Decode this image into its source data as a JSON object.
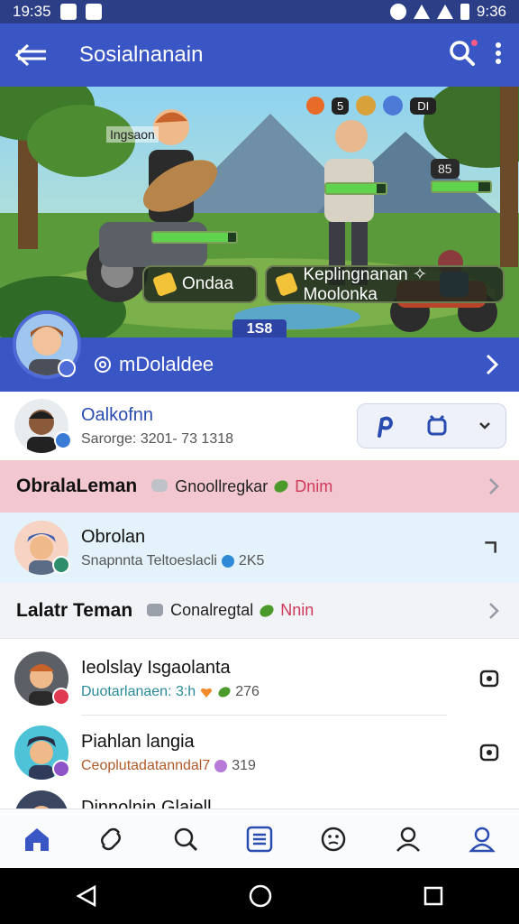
{
  "status_bar": {
    "time": "19:35",
    "time_right": "9:36"
  },
  "app_bar": {
    "title": "Sosialnanain"
  },
  "banner": {
    "hud_top": "5",
    "hud_top_right": "DI",
    "hero_label": "Ingsaon",
    "score": "85",
    "level": "1S8",
    "chip_left": "Ondaa",
    "chip_right": "Keplingnanan ✧ Moolonka"
  },
  "profile": {
    "handle": "mDolaldee"
  },
  "friend_card": {
    "name": "Oalkofnn",
    "sub": "Sarorge: 3201- 73  1318"
  },
  "sections": [
    {
      "title": "ObralaLeman",
      "meta": "Gnoollregkar",
      "accent": "Dnim",
      "color": "#f2c7d0"
    },
    {
      "title": "Lalatr Teman",
      "meta": "Conalregtal",
      "accent": "Nnin",
      "color": "#f2f3f6"
    }
  ],
  "highlight_row": {
    "name": "Obrolan",
    "sub": "Snapnnta Teltoeslacli",
    "count": "2K5"
  },
  "list": [
    {
      "name": "Ieolslay Isgaolanta",
      "sub": "Duotarlanaen: 3:h",
      "count": "276",
      "badge_color": "#e03a53"
    },
    {
      "name": "Piahlan langia",
      "sub": "Ceoplutadatanndal7",
      "count": "319",
      "badge_color": "#8e55c8"
    },
    {
      "name": "Dinnolnin Glaiell",
      "sub": "",
      "count": "",
      "badge_color": "#4f6bd8"
    }
  ],
  "colors": {
    "primary": "#3a56c5",
    "status": "#2c3f86",
    "pink": "#f2c7d0",
    "lightblue": "#e4f3fb"
  },
  "icons": {
    "app_bar": [
      "back-arrow-icon",
      "notification-search-icon",
      "more-vert-icon"
    ],
    "nav": [
      "home-icon",
      "link-icon",
      "search-icon",
      "list-icon",
      "emoji-icon",
      "profile-icon",
      "account-icon"
    ]
  }
}
